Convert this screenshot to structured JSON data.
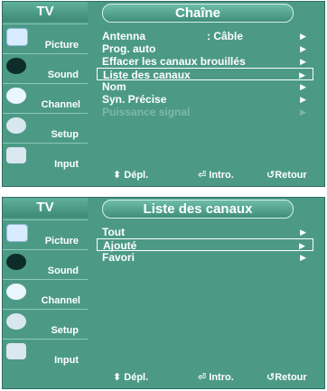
{
  "panels": [
    {
      "tv_label": "TV",
      "title": "Chaîne",
      "sidebar": [
        "Picture",
        "Sound",
        "Channel",
        "Setup",
        "Input"
      ],
      "menu": [
        {
          "label": "Antenna",
          "value": ": Câble",
          "arrow": "▶"
        },
        {
          "label": "Prog. auto",
          "arrow": "▶"
        },
        {
          "label": "Effacer les canaux brouillés",
          "arrow": "▶"
        },
        {
          "label": "Liste des canaux",
          "arrow": "▶",
          "selected": true
        },
        {
          "label": "Nom",
          "arrow": "▶"
        },
        {
          "label": "Syn. Précise",
          "arrow": "▶"
        },
        {
          "label": "Puissance signal",
          "arrow": "▶",
          "disabled": true
        }
      ],
      "footer": {
        "move": "⬍ Dépl.",
        "enter": "⏎ Intro.",
        "back": "↺Retour"
      }
    },
    {
      "tv_label": "TV",
      "title": "Liste des canaux",
      "sidebar": [
        "Picture",
        "Sound",
        "Channel",
        "Setup",
        "Input"
      ],
      "menu": [
        {
          "label": "Tout",
          "arrow": "▶"
        },
        {
          "label": "Ajouté",
          "arrow": "▶",
          "selected": true
        },
        {
          "label": "Favori",
          "arrow": "▶"
        }
      ],
      "footer": {
        "move": "⬍ Dépl.",
        "enter": "⏎ Intro.",
        "back": "↺Retour"
      }
    }
  ],
  "icons": [
    "picture-icon",
    "sound-icon",
    "channel-icon",
    "setup-icon",
    "input-icon"
  ],
  "colors": {
    "panel": "#4c9a86",
    "text": "#ffffff",
    "disabled": "#7fb7a9"
  }
}
